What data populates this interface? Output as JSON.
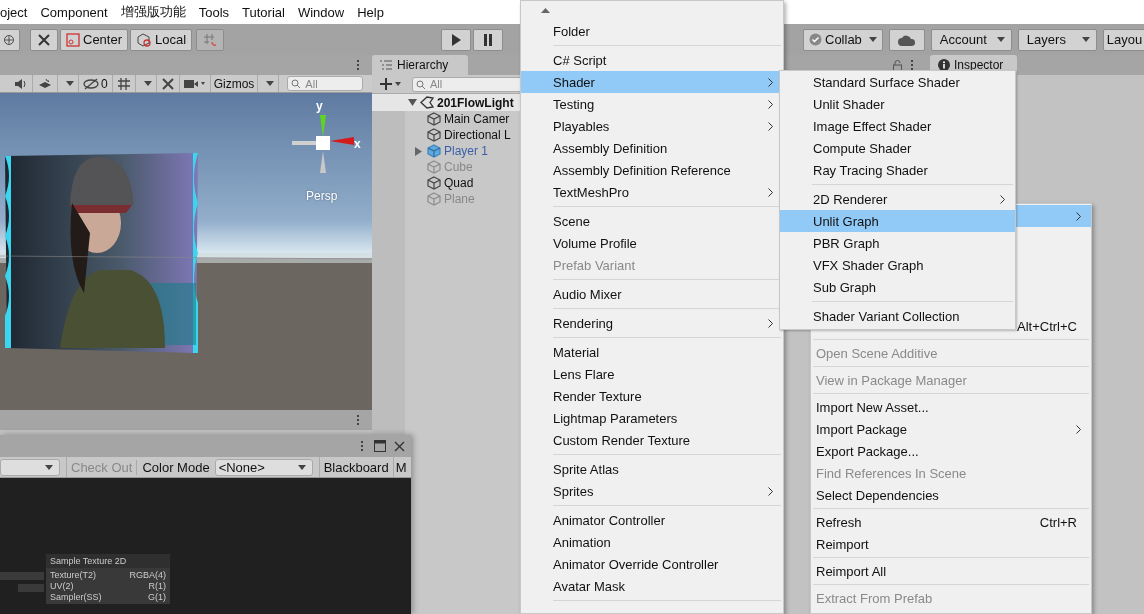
{
  "menu_bar": [
    "oject",
    "Component",
    "增强版功能",
    "Tools",
    "Tutorial",
    "Window",
    "Help"
  ],
  "toolbar": {
    "pivot_mode": "Center",
    "pivot_space": "Local",
    "collab": "Collab",
    "account": "Account",
    "layers": "Layers",
    "layout": "Layou"
  },
  "scene_view": {
    "hidden_count": "0",
    "gizmos": "Gizmos",
    "search_placeholder": "All",
    "axis_y": "y",
    "axis_x": "x",
    "projection": "Persp"
  },
  "hierarchy": {
    "tab": "Hierarchy",
    "search_placeholder": "All",
    "scene": {
      "name": "201FlowLight",
      "expanded": true,
      "children": [
        {
          "name": "Main Camer",
          "active": true,
          "prefab": false,
          "expandable": false
        },
        {
          "name": "Directional L",
          "active": true,
          "prefab": false,
          "expandable": false
        },
        {
          "name": "Player 1",
          "active": true,
          "prefab": true,
          "expandable": true
        },
        {
          "name": "Cube",
          "active": false,
          "prefab": false,
          "expandable": false
        },
        {
          "name": "Quad",
          "active": true,
          "prefab": false,
          "expandable": false
        },
        {
          "name": "Plane",
          "active": false,
          "prefab": false,
          "expandable": false
        }
      ]
    }
  },
  "inspector": {
    "tab": "Inspector"
  },
  "create_menu": {
    "items": [
      {
        "kind": "scroll_up"
      },
      {
        "kind": "item",
        "label": "Folder",
        "selected": false,
        "disabled": false,
        "submenu": false
      },
      {
        "kind": "separator"
      },
      {
        "kind": "item",
        "label": "C# Script",
        "selected": false,
        "disabled": false,
        "submenu": false
      },
      {
        "kind": "item",
        "label": "Shader",
        "selected": true,
        "disabled": false,
        "submenu": true
      },
      {
        "kind": "item",
        "label": "Testing",
        "selected": false,
        "disabled": false,
        "submenu": true
      },
      {
        "kind": "item",
        "label": "Playables",
        "selected": false,
        "disabled": false,
        "submenu": true
      },
      {
        "kind": "item",
        "label": "Assembly Definition",
        "selected": false,
        "disabled": false,
        "submenu": false
      },
      {
        "kind": "item",
        "label": "Assembly Definition Reference",
        "selected": false,
        "disabled": false,
        "submenu": false
      },
      {
        "kind": "item",
        "label": "TextMeshPro",
        "selected": false,
        "disabled": false,
        "submenu": true
      },
      {
        "kind": "separator"
      },
      {
        "kind": "item",
        "label": "Scene",
        "selected": false,
        "disabled": false,
        "submenu": false
      },
      {
        "kind": "item",
        "label": "Volume Profile",
        "selected": false,
        "disabled": false,
        "submenu": false
      },
      {
        "kind": "item",
        "label": "Prefab Variant",
        "selected": false,
        "disabled": true,
        "submenu": false
      },
      {
        "kind": "separator"
      },
      {
        "kind": "item",
        "label": "Audio Mixer",
        "selected": false,
        "disabled": false,
        "submenu": false
      },
      {
        "kind": "separator"
      },
      {
        "kind": "item",
        "label": "Rendering",
        "selected": false,
        "disabled": false,
        "submenu": true
      },
      {
        "kind": "separator"
      },
      {
        "kind": "item",
        "label": "Material",
        "selected": false,
        "disabled": false,
        "submenu": false
      },
      {
        "kind": "item",
        "label": "Lens Flare",
        "selected": false,
        "disabled": false,
        "submenu": false
      },
      {
        "kind": "item",
        "label": "Render Texture",
        "selected": false,
        "disabled": false,
        "submenu": false
      },
      {
        "kind": "item",
        "label": "Lightmap Parameters",
        "selected": false,
        "disabled": false,
        "submenu": false
      },
      {
        "kind": "item",
        "label": "Custom Render Texture",
        "selected": false,
        "disabled": false,
        "submenu": false
      },
      {
        "kind": "separator"
      },
      {
        "kind": "item",
        "label": "Sprite Atlas",
        "selected": false,
        "disabled": false,
        "submenu": false
      },
      {
        "kind": "item",
        "label": "Sprites",
        "selected": false,
        "disabled": false,
        "submenu": true
      },
      {
        "kind": "separator"
      },
      {
        "kind": "item",
        "label": "Animator Controller",
        "selected": false,
        "disabled": false,
        "submenu": false
      },
      {
        "kind": "item",
        "label": "Animation",
        "selected": false,
        "disabled": false,
        "submenu": false
      },
      {
        "kind": "item",
        "label": "Animator Override Controller",
        "selected": false,
        "disabled": false,
        "submenu": false
      },
      {
        "kind": "item",
        "label": "Avatar Mask",
        "selected": false,
        "disabled": false,
        "submenu": false
      },
      {
        "kind": "separator"
      }
    ]
  },
  "shader_menu": {
    "items": [
      {
        "kind": "item",
        "label": "Standard Surface Shader",
        "selected": false,
        "disabled": false,
        "submenu": false
      },
      {
        "kind": "item",
        "label": "Unlit Shader",
        "selected": false,
        "disabled": false,
        "submenu": false
      },
      {
        "kind": "item",
        "label": "Image Effect Shader",
        "selected": false,
        "disabled": false,
        "submenu": false
      },
      {
        "kind": "item",
        "label": "Compute Shader",
        "selected": false,
        "disabled": false,
        "submenu": false
      },
      {
        "kind": "item",
        "label": "Ray Tracing Shader",
        "selected": false,
        "disabled": false,
        "submenu": false
      },
      {
        "kind": "separator"
      },
      {
        "kind": "item",
        "label": "2D Renderer",
        "selected": false,
        "disabled": false,
        "submenu": true
      },
      {
        "kind": "item",
        "label": "Unlit Graph",
        "selected": true,
        "disabled": false,
        "submenu": false
      },
      {
        "kind": "item",
        "label": "PBR Graph",
        "selected": false,
        "disabled": false,
        "submenu": false
      },
      {
        "kind": "item",
        "label": "VFX Shader Graph",
        "selected": false,
        "disabled": false,
        "submenu": false
      },
      {
        "kind": "item",
        "label": "Sub Graph",
        "selected": false,
        "disabled": false,
        "submenu": false
      },
      {
        "kind": "separator"
      },
      {
        "kind": "item",
        "label": "Shader Variant Collection",
        "selected": false,
        "disabled": false,
        "submenu": false
      }
    ]
  },
  "context_menu": {
    "items": [
      {
        "kind": "item",
        "selected": true,
        "disabled": false,
        "submenu": true
      },
      {
        "kind": "covered"
      },
      {
        "kind": "covered"
      },
      {
        "kind": "covered"
      },
      {
        "kind": "covered"
      },
      {
        "kind": "item",
        "shortcut": "Alt+Ctrl+C",
        "selected": false,
        "disabled": false,
        "submenu": false
      },
      {
        "kind": "separator"
      },
      {
        "kind": "item",
        "label": "Open Scene Additive",
        "selected": false,
        "disabled": true,
        "submenu": false
      },
      {
        "kind": "separator"
      },
      {
        "kind": "item",
        "label": "View in Package Manager",
        "selected": false,
        "disabled": true,
        "submenu": false
      },
      {
        "kind": "separator"
      },
      {
        "kind": "item",
        "label": "Import New Asset...",
        "selected": false,
        "disabled": false,
        "submenu": false
      },
      {
        "kind": "item",
        "label": "Import Package",
        "selected": false,
        "disabled": false,
        "submenu": true
      },
      {
        "kind": "item",
        "label": "Export Package...",
        "selected": false,
        "disabled": false,
        "submenu": false
      },
      {
        "kind": "item",
        "label": "Find References In Scene",
        "selected": false,
        "disabled": true,
        "submenu": false
      },
      {
        "kind": "item",
        "label": "Select Dependencies",
        "selected": false,
        "disabled": false,
        "submenu": false
      },
      {
        "kind": "separator"
      },
      {
        "kind": "item",
        "label": "Refresh",
        "shortcut": "Ctrl+R",
        "selected": false,
        "disabled": false,
        "submenu": false
      },
      {
        "kind": "item",
        "label": "Reimport",
        "selected": false,
        "disabled": false,
        "submenu": false
      },
      {
        "kind": "separator"
      },
      {
        "kind": "item",
        "label": "Reimport All",
        "selected": false,
        "disabled": false,
        "submenu": false
      },
      {
        "kind": "separator"
      },
      {
        "kind": "item",
        "label": "Extract From Prefab",
        "selected": false,
        "disabled": true,
        "submenu": false
      }
    ]
  },
  "shader_graph": {
    "check_out": "Check Out",
    "check_out_disabled": true,
    "color_mode_label": "Color Mode",
    "color_mode": "<None>",
    "blackboard": "Blackboard",
    "cut_button": "M",
    "node": {
      "title": "Sample Texture 2D",
      "inputs": [
        "Texture(T2)",
        "UV(2)",
        "Sampler(SS)"
      ],
      "outputs": [
        "RGBA(4)",
        "R(1)",
        "G(1)"
      ]
    }
  }
}
